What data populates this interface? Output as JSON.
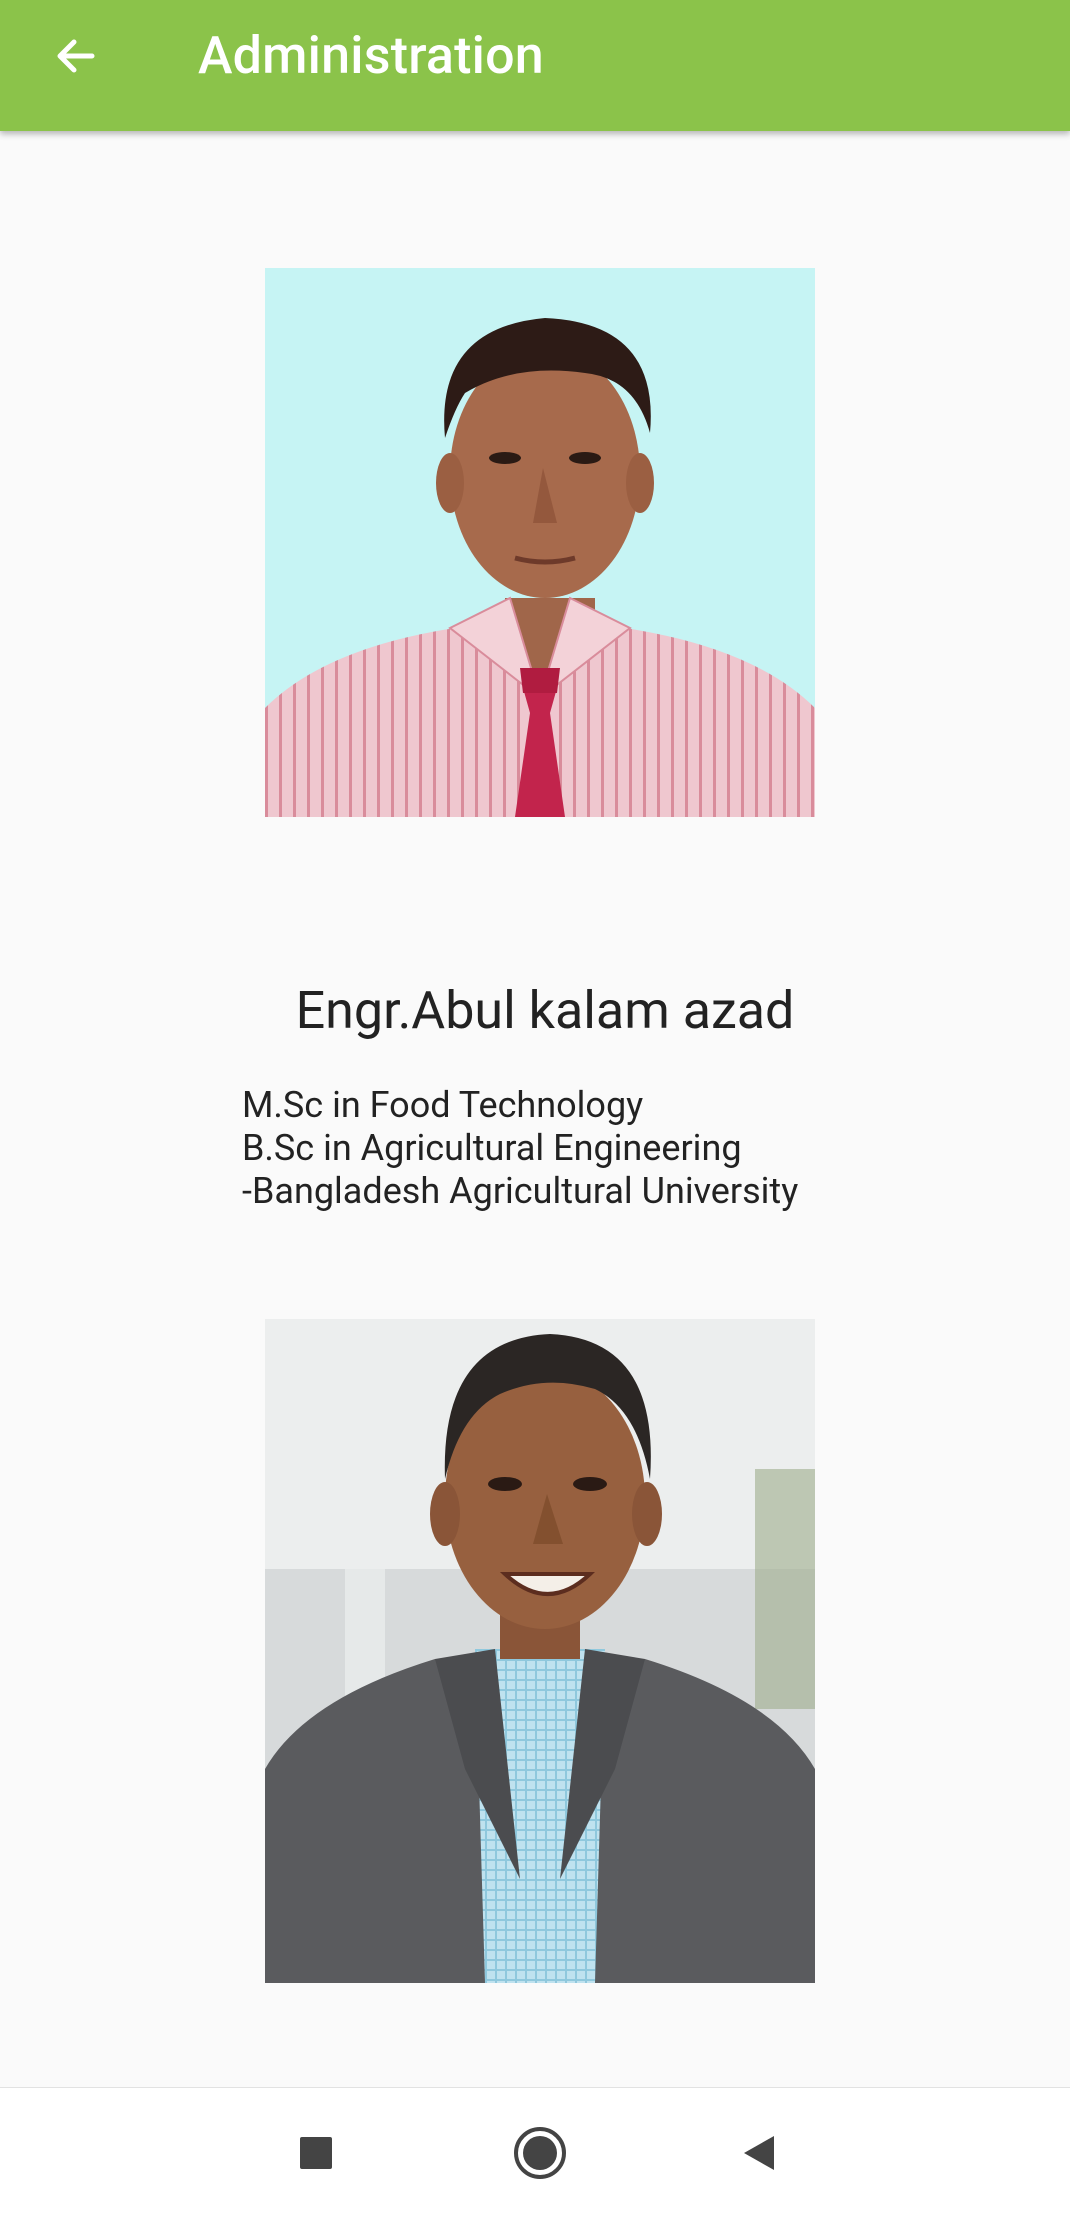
{
  "app_bar": {
    "title": "Administration",
    "background_color": "#8bc34a",
    "back_icon": "arrow-left-icon"
  },
  "administrators": [
    {
      "photo": "portrait-photo",
      "name": "Engr.Abul kalam azad",
      "qualifications": [
        "M.Sc in Food Technology",
        "B.Sc in Agricultural Engineering",
        "-Bangladesh Agricultural University"
      ]
    },
    {
      "photo": "portrait-photo"
    }
  ],
  "nav_bar": {
    "recents_icon": "square-icon",
    "home_icon": "circle-icon",
    "back_icon": "triangle-back-icon"
  }
}
